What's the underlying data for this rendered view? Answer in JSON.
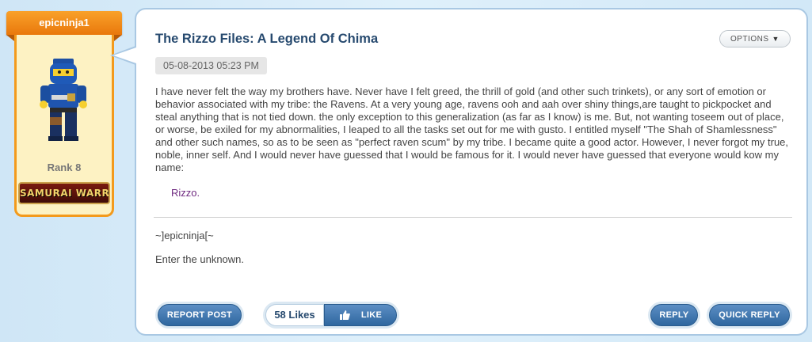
{
  "user": {
    "username": "epicninja1",
    "rank": "Rank 8",
    "badge": "SAMURAI WARRIOR"
  },
  "post": {
    "title": "The Rizzo Files: A Legend Of Chima",
    "options_label": "OPTIONS",
    "timestamp": "05-08-2013 05:23 PM",
    "body": "I have never felt the way my brothers have. Never have I felt greed, the thrill of gold (and other such trinkets), or any sort of emotion or behavior associated with my tribe: the Ravens. At a very young age, ravens ooh and aah over shiny things,are taught to pickpocket and steal anything that is not tied down. the only exception to this generalization (as far as I know) is me. But, not wanting toseem out of place, or worse, be exiled for my abnormalities, I leaped to all the tasks set out for me with gusto. I entitled myself \"The Shah of Shamlessness\" and other such names, so as to be seen as \"perfect raven scum\" by my tribe. I became quite a good actor. However, I never forgot my true, noble, inner self. And I would never have guessed that I would be famous for it. I would never have guessed that everyone would kow my name:",
    "indent_text": "Rizzo.",
    "signature_line1": "~]epicninja[~",
    "signature_line2": "Enter the unknown."
  },
  "actions": {
    "report": "REPORT POST",
    "likes_count": "58 Likes",
    "like": "LIKE",
    "reply": "REPLY",
    "quick_reply": "QUICK REPLY"
  },
  "colors": {
    "accent_orange": "#f39a1c",
    "button_blue": "#2f679f",
    "title_blue": "#274a6f"
  }
}
